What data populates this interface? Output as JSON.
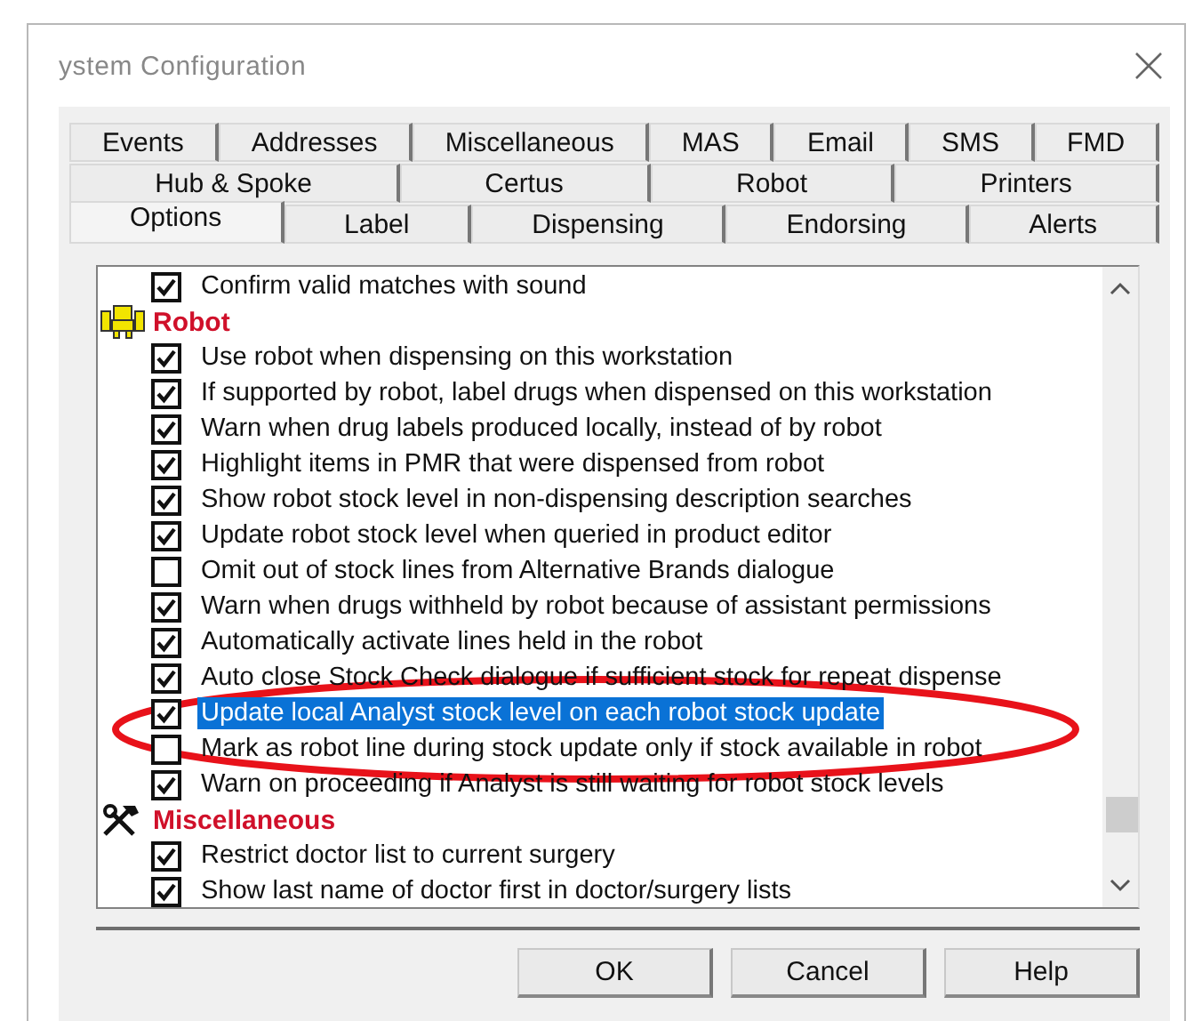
{
  "window": {
    "title": "ystem Configuration"
  },
  "tab_rows": [
    [
      {
        "label": "Events",
        "selected": false
      },
      {
        "label": "Addresses",
        "selected": false
      },
      {
        "label": "Miscellaneous",
        "selected": false
      },
      {
        "label": "MAS",
        "selected": false
      },
      {
        "label": "Email",
        "selected": false
      },
      {
        "label": "SMS",
        "selected": false
      },
      {
        "label": "FMD",
        "selected": false
      }
    ],
    [
      {
        "label": "Hub & Spoke",
        "selected": false
      },
      {
        "label": "Certus",
        "selected": false
      },
      {
        "label": "Robot",
        "selected": false
      },
      {
        "label": "Printers",
        "selected": false
      }
    ],
    [
      {
        "label": "Options",
        "selected": true
      },
      {
        "label": "Label",
        "selected": false
      },
      {
        "label": "Dispensing",
        "selected": false
      },
      {
        "label": "Endorsing",
        "selected": false
      },
      {
        "label": "Alerts",
        "selected": false
      }
    ]
  ],
  "options": [
    {
      "kind": "option",
      "label": "Confirm valid matches with sound",
      "checked": true,
      "selected": false
    },
    {
      "kind": "header",
      "label": "Robot"
    },
    {
      "kind": "option",
      "label": "Use robot when dispensing on this workstation",
      "checked": true,
      "selected": false
    },
    {
      "kind": "option",
      "label": "If supported by robot, label drugs when dispensed on this workstation",
      "checked": true,
      "selected": false
    },
    {
      "kind": "option",
      "label": "Warn when drug labels produced locally, instead of by robot",
      "checked": true,
      "selected": false
    },
    {
      "kind": "option",
      "label": "Highlight items in PMR that were dispensed from robot",
      "checked": true,
      "selected": false
    },
    {
      "kind": "option",
      "label": "Show robot stock level in non-dispensing description searches",
      "checked": true,
      "selected": false
    },
    {
      "kind": "option",
      "label": "Update robot stock level when queried in product editor",
      "checked": true,
      "selected": false
    },
    {
      "kind": "option",
      "label": "Omit out of stock lines from Alternative Brands dialogue",
      "checked": false,
      "selected": false
    },
    {
      "kind": "option",
      "label": "Warn when drugs withheld by robot because of assistant permissions",
      "checked": true,
      "selected": false
    },
    {
      "kind": "option",
      "label": "Automatically activate lines held in the robot",
      "checked": true,
      "selected": false
    },
    {
      "kind": "option",
      "label": "Auto close Stock Check dialogue if sufficient stock for repeat dispense",
      "checked": true,
      "selected": false
    },
    {
      "kind": "option",
      "label": "Update local Analyst stock level on each robot stock update",
      "checked": true,
      "selected": true
    },
    {
      "kind": "option",
      "label": "Mark as robot line during stock update only if stock available in robot",
      "checked": false,
      "selected": false
    },
    {
      "kind": "option",
      "label": "Warn on proceeding if Analyst is still waiting for robot stock levels",
      "checked": true,
      "selected": false
    },
    {
      "kind": "header",
      "label": "Miscellaneous"
    },
    {
      "kind": "option",
      "label": "Restrict doctor list to current surgery",
      "checked": true,
      "selected": false
    },
    {
      "kind": "option",
      "label": "Show last name of doctor first in doctor/surgery lists",
      "checked": true,
      "selected": false
    }
  ],
  "buttons": [
    "OK",
    "Cancel",
    "Help"
  ]
}
